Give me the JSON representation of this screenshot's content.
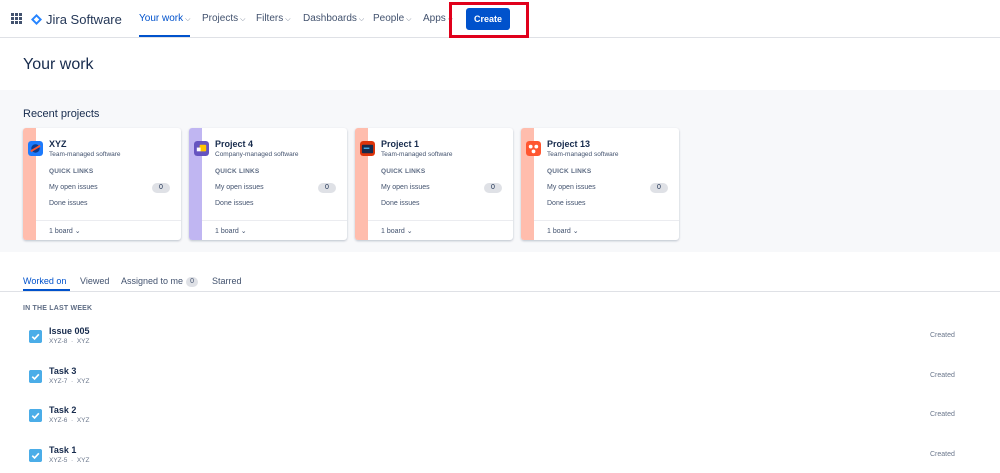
{
  "app": {
    "name": "Jira Software"
  },
  "nav": {
    "items": [
      {
        "label": "Your work",
        "active": true
      },
      {
        "label": "Projects"
      },
      {
        "label": "Filters"
      },
      {
        "label": "Dashboards"
      },
      {
        "label": "People"
      },
      {
        "label": "Apps"
      }
    ],
    "create_label": "Create"
  },
  "page": {
    "title": "Your work"
  },
  "recent": {
    "title": "Recent projects",
    "projects": [
      {
        "name": "XYZ",
        "type": "Team-managed software",
        "quick_links": "QUICK LINKS",
        "open_issues_label": "My open issues",
        "open_issues_count": "0",
        "done_label": "Done issues",
        "board_label": "1 board",
        "stripe_color": "#ffbdad",
        "avatar_color": "#1d7afc"
      },
      {
        "name": "Project 4",
        "type": "Company-managed software",
        "quick_links": "QUICK LINKS",
        "open_issues_label": "My open issues",
        "open_issues_count": "0",
        "done_label": "Done issues",
        "board_label": "1 board",
        "stripe_color": "#c0b6f2",
        "avatar_color": "#6554c0"
      },
      {
        "name": "Project 1",
        "type": "Team-managed software",
        "quick_links": "QUICK LINKS",
        "open_issues_label": "My open issues",
        "open_issues_count": "0",
        "done_label": "Done issues",
        "board_label": "1 board",
        "stripe_color": "#ffbdad",
        "avatar_color": "#de350b"
      },
      {
        "name": "Project 13",
        "type": "Team-managed software",
        "quick_links": "QUICK LINKS",
        "open_issues_label": "My open issues",
        "open_issues_count": "0",
        "done_label": "Done issues",
        "board_label": "1 board",
        "stripe_color": "#ffbdad",
        "avatar_color": "#ff5630"
      }
    ]
  },
  "tabs": {
    "items": [
      {
        "label": "Worked on",
        "active": true
      },
      {
        "label": "Viewed"
      },
      {
        "label": "Assigned to me",
        "badge": "0"
      },
      {
        "label": "Starred"
      }
    ]
  },
  "worked_on": {
    "section_label": "IN THE LAST WEEK",
    "items": [
      {
        "title": "Issue 005",
        "key": "XYZ-8",
        "project": "XYZ",
        "status": "Created"
      },
      {
        "title": "Task 3",
        "key": "XYZ-7",
        "project": "XYZ",
        "status": "Created"
      },
      {
        "title": "Task 2",
        "key": "XYZ-6",
        "project": "XYZ",
        "status": "Created"
      },
      {
        "title": "Task 1",
        "key": "XYZ-5",
        "project": "XYZ",
        "status": "Created"
      }
    ]
  },
  "colors": {
    "brand": "#0052cc",
    "text": "#172b4d",
    "highlight": "#e0001b",
    "checkbox": "#4bade8"
  }
}
